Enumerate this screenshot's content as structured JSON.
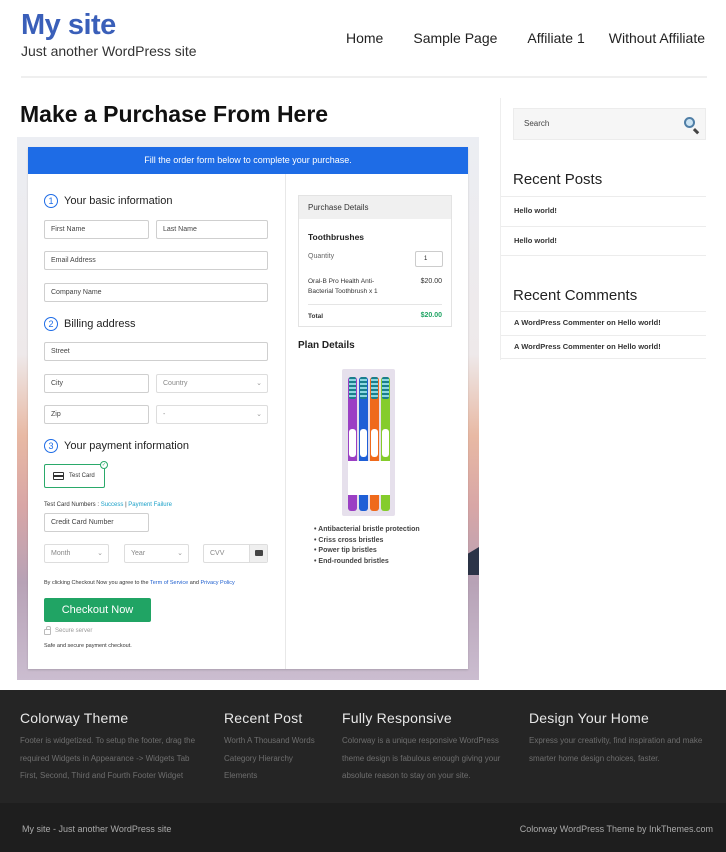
{
  "header": {
    "site_title": "My site",
    "tagline": "Just another WordPress site",
    "nav": [
      "Home",
      "Sample Page",
      "Affiliate 1",
      "Without Affiliate"
    ]
  },
  "page": {
    "title": "Make a Purchase From Here"
  },
  "checkout": {
    "banner": "Fill the order form below to complete your purchase.",
    "sections": [
      {
        "num": "1",
        "title": "Your basic information"
      },
      {
        "num": "2",
        "title": "Billing address"
      },
      {
        "num": "3",
        "title": "Your payment information"
      }
    ],
    "fields": {
      "first_name": "First Name",
      "last_name": "Last Name",
      "email": "Email Address",
      "company": "Company Name",
      "street": "Street",
      "city": "City",
      "country": "Country",
      "zip": "Zip",
      "state": "-",
      "card_number": "Credit Card Number",
      "month": "Month",
      "year": "Year",
      "cvv": "CVV"
    },
    "payment_method": "Test Card",
    "test_card_label": "Test Card Numbers :",
    "test_success": "Success",
    "test_separator": "|",
    "test_failure": "Payment Failure",
    "terms_prefix": "By clicking Checkout Now you agree to the",
    "terms_link": "Term of Service",
    "terms_and": "and",
    "privacy_link": "Privacy Policy",
    "checkout_button": "Checkout Now",
    "secure_server": "Secure server",
    "secure_note": "Safe and secure payment checkout.",
    "purchase_details": {
      "heading": "Purchase Details",
      "product": "Toothbrushes",
      "quantity_label": "Quantity",
      "quantity_value": "1",
      "line_item_1": "Oral-B Pro Health Anti-",
      "line_item_2": "Bacterial Toothbrush x 1",
      "line_price": "$20.00",
      "total_label": "Total",
      "total_value": "$20.00"
    },
    "plan_details": {
      "heading": "Plan Details",
      "features": [
        "Antibacterial bristle protection",
        "Criss cross bristles",
        "Power tip bristles",
        "End-rounded bristles"
      ]
    },
    "colors": {
      "banner": "#1e6ce6",
      "button": "#20a464",
      "total": "#20a464"
    }
  },
  "sidebar": {
    "search_placeholder": "Search",
    "recent_posts_title": "Recent Posts",
    "recent_posts": [
      "Hello world!",
      "Hello world!"
    ],
    "recent_comments_title": "Recent Comments",
    "recent_comments": [
      "A WordPress Commenter on Hello world!",
      "A WordPress Commenter on Hello world!"
    ]
  },
  "footer": {
    "columns": [
      {
        "title": "Colorway Theme",
        "lines": [
          "Footer is widgetized. To setup the footer, drag the",
          "required Widgets in Appearance -> Widgets Tab",
          "First, Second, Third and Fourth Footer Widget"
        ]
      },
      {
        "title": "Recent Post",
        "lines": [
          "Worth A Thousand Words",
          "Category Hierarchy",
          "Elements"
        ]
      },
      {
        "title": "Fully Responsive",
        "lines": [
          "Colorway is a unique responsive WordPress",
          "theme design is fabulous enough giving your",
          "absolute reason to stay on your site."
        ]
      },
      {
        "title": "Design Your Home",
        "lines": [
          "Express your creativity, find inspiration and make",
          "smarter home design choices, faster."
        ]
      }
    ],
    "bottom_left": "My site - Just another WordPress site",
    "bottom_right": "Colorway WordPress Theme by InkThemes.com"
  }
}
